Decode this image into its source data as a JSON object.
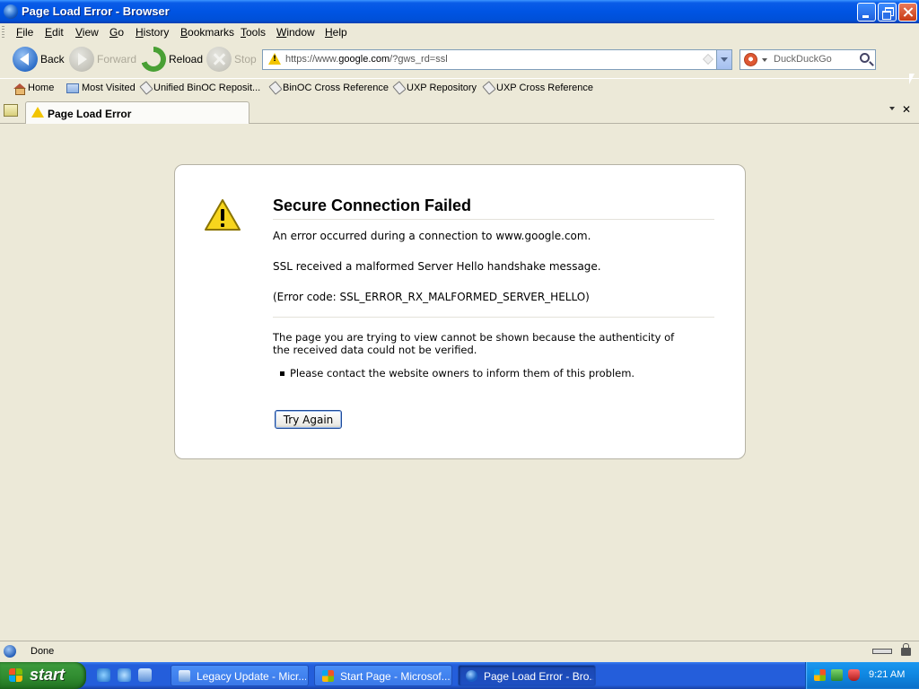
{
  "window": {
    "title": "Page Load Error - Browser"
  },
  "menu": [
    "File",
    "Edit",
    "View",
    "Go",
    "History",
    "Bookmarks",
    "Tools",
    "Window",
    "Help"
  ],
  "nav": {
    "back_label": "Back",
    "forward_label": "Forward",
    "reload_label": "Reload",
    "stop_label": "Stop",
    "url_prefix": "https://www.",
    "url_host": "google.com",
    "url_suffix": "/?gws_rd=ssl",
    "search_placeholder": "DuckDuckGo"
  },
  "bookmarks": [
    "Home",
    "Most Visited",
    "Unified BinOC Reposit...",
    "BinOC Cross Reference",
    "UXP Repository",
    "UXP Cross Reference"
  ],
  "tab": {
    "label": "Page Load Error"
  },
  "error": {
    "title": "Secure Connection Failed",
    "line1": "An error occurred during a connection to www.google.com.",
    "line2": "SSL received a malformed Server Hello handshake message.",
    "line3": "(Error code: SSL_ERROR_RX_MALFORMED_SERVER_HELLO)",
    "description": "The page you are trying to view cannot be shown because the authenticity of the received data could not be verified.",
    "bullet": "Please contact the website owners to inform them of this problem.",
    "button_label": "Try Again"
  },
  "status": {
    "text": "Done"
  },
  "taskbar": {
    "start_label": "start",
    "items": [
      {
        "label": "Legacy Update - Micr...",
        "active": false
      },
      {
        "label": "Start Page - Microsof...",
        "active": false
      },
      {
        "label": "Page Load Error - Bro...",
        "active": true
      }
    ],
    "clock": "9:21 AM"
  },
  "colors": {
    "xp_blue": "#0054e3",
    "chrome_bg": "#ece9d8",
    "warning_yellow": "#f2c500",
    "start_green": "#2f8a2f"
  }
}
